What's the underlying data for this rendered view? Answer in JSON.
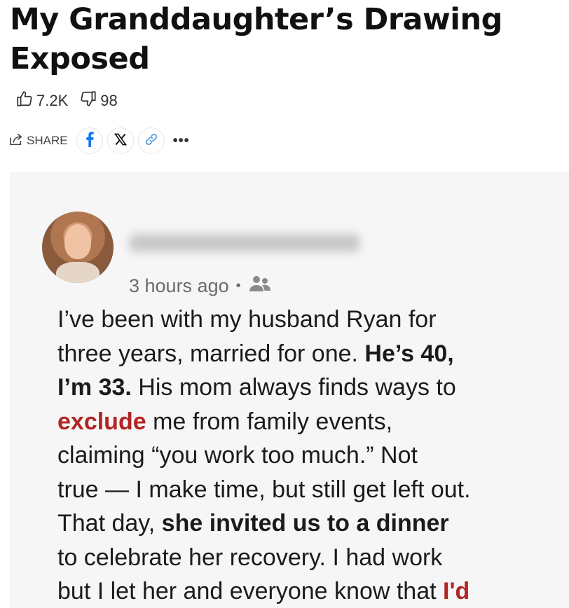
{
  "article": {
    "title": "My Granddaughter’s Drawing Exposed"
  },
  "reactions": {
    "likes": "7.2K",
    "dislikes": "98"
  },
  "share": {
    "label": "SHARE",
    "more": "•••"
  },
  "icons": {
    "like": "thumbs-up-icon",
    "dislike": "thumbs-down-icon",
    "share": "share-icon",
    "facebook": "facebook-icon",
    "x": "x-icon",
    "link": "link-icon",
    "audience": "friends-icon"
  },
  "colors": {
    "facebook": "#1877f2",
    "link": "#5aa0e0",
    "highlight": "#b32424"
  },
  "post": {
    "timestamp": "3 hours ago",
    "separator": "•",
    "lines": [
      [
        {
          "t": "I’ve been with my husband Ryan for",
          "s": ""
        }
      ],
      [
        {
          "t": "three years, married for one. ",
          "s": ""
        },
        {
          "t": "He’s 40,",
          "s": "b"
        }
      ],
      [
        {
          "t": "I’m 33.",
          "s": "b"
        },
        {
          "t": " His mom always finds ways to",
          "s": ""
        }
      ],
      [
        {
          "t": "exclude",
          "s": "r"
        },
        {
          "t": " me from family events,",
          "s": ""
        }
      ],
      [
        {
          "t": "claiming “you work too much.” Not",
          "s": ""
        }
      ],
      [
        {
          "t": "true — I make time, but still get left out.",
          "s": ""
        }
      ],
      [
        {
          "t": "That day, ",
          "s": ""
        },
        {
          "t": "she invited us to a dinner",
          "s": "b"
        }
      ],
      [
        {
          "t": "to celebrate her recovery. I had work",
          "s": ""
        }
      ],
      [
        {
          "t": "but I let her and everyone know that ",
          "s": ""
        },
        {
          "t": "I'd",
          "s": "r"
        }
      ]
    ]
  }
}
